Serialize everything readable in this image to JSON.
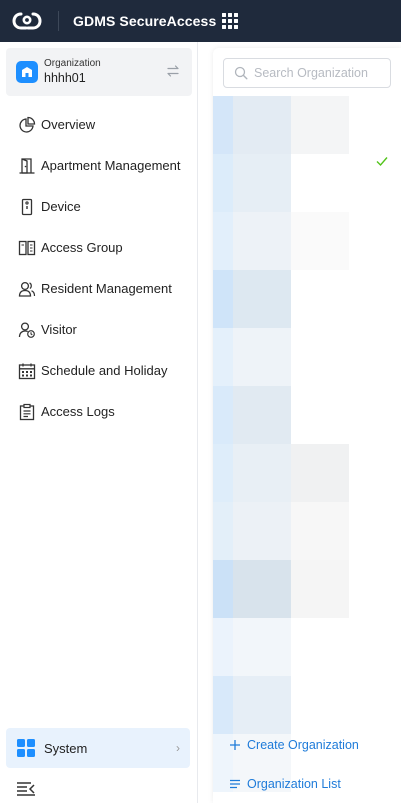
{
  "header": {
    "app_title": "GDMS SecureAccess"
  },
  "sidebar": {
    "organization": {
      "label": "Organization",
      "value": "hhhh01"
    },
    "items": [
      {
        "label": "Overview",
        "icon": "pie-chart-icon"
      },
      {
        "label": "Apartment Management",
        "icon": "door-icon"
      },
      {
        "label": "Device",
        "icon": "device-icon"
      },
      {
        "label": "Access Group",
        "icon": "access-group-icon"
      },
      {
        "label": "Resident Management",
        "icon": "users-icon"
      },
      {
        "label": "Visitor",
        "icon": "visitor-icon"
      },
      {
        "label": "Schedule and Holiday",
        "icon": "calendar-icon"
      },
      {
        "label": "Access Logs",
        "icon": "log-icon"
      }
    ],
    "system": {
      "label": "System"
    }
  },
  "org_panel": {
    "search_placeholder": "Search Organization",
    "rows": [
      {
        "shades": [
          "#d4e6f9",
          "#e3ebf3",
          "#f4f5f6"
        ],
        "selected": false
      },
      {
        "shades": [
          "#dcecfa",
          "#e6eef5",
          "#ffffff"
        ],
        "selected": true
      },
      {
        "shades": [
          "#e2effb",
          "#edf2f7",
          "#fafafa"
        ],
        "selected": false
      },
      {
        "shades": [
          "#cfe4f9",
          "#dde8f1",
          "#ffffff"
        ],
        "selected": false
      },
      {
        "shades": [
          "#e4f0fb",
          "#eef3f8",
          "#ffffff"
        ],
        "selected": false
      },
      {
        "shades": [
          "#d9eafa",
          "#e1eaf2",
          "#ffffff"
        ],
        "selected": false
      },
      {
        "shades": [
          "#deedfa",
          "#e8eff5",
          "#f0f1f2"
        ],
        "selected": false
      },
      {
        "shades": [
          "#e3eff9",
          "#ecf1f6",
          "#f7f7f7"
        ],
        "selected": false
      },
      {
        "shades": [
          "#cbe1f7",
          "#d8e3ec",
          "#f5f5f5"
        ],
        "selected": false
      },
      {
        "shades": [
          "#ebf3fc",
          "#f2f6fa",
          "#ffffff"
        ],
        "selected": false
      },
      {
        "shades": [
          "#d8e9fa",
          "#e6eef6",
          "#ffffff"
        ],
        "selected": false
      },
      {
        "shades": [
          "#eef5fc",
          "#f4f7fa",
          "#ffffff"
        ],
        "selected": false
      }
    ],
    "create_label": "Create Organization",
    "list_label": "Organization List"
  },
  "colors": {
    "header_bg": "#1f2a3c",
    "accent": "#1e8fff",
    "link": "#1e7bd9",
    "check": "#52c41a"
  }
}
